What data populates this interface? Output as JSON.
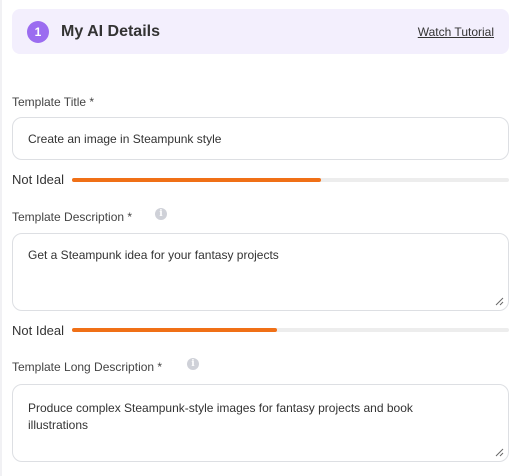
{
  "section": {
    "step_number": "1",
    "title": "My AI Details",
    "tutorial_link": "Watch Tutorial"
  },
  "fields": {
    "template_title": {
      "label": "Template Title *",
      "value": "Create an image in Steampunk style",
      "rating": {
        "label": "Not Ideal",
        "level": 0.57,
        "color": "#f07017"
      }
    },
    "template_description": {
      "label": "Template Description *",
      "value": "Get a Steampunk idea for your fantasy projects",
      "rating": {
        "label": "Not Ideal",
        "level": 0.47,
        "color": "#f07017"
      }
    },
    "template_long_description": {
      "label": "Template Long Description *",
      "value": "Produce complex Steampunk-style images for fantasy projects and book illustrations"
    }
  },
  "icons": {
    "info": "info-icon",
    "resize": "resize-handle-icon"
  },
  "colors": {
    "accent": "#9b6cf0",
    "header_bg": "#f3effd",
    "rating_fill": "#f07017"
  }
}
